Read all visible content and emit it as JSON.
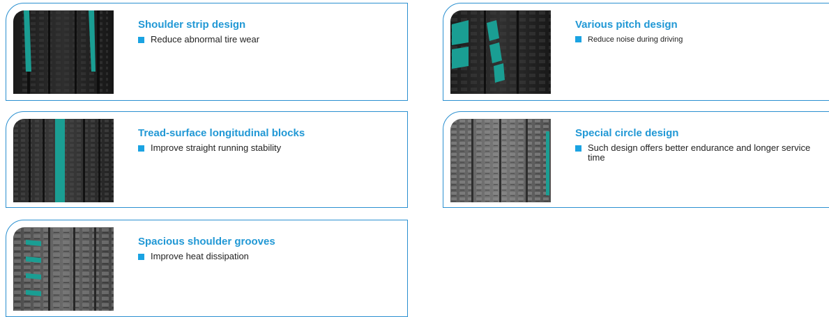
{
  "cards": [
    {
      "title": "Shoulder strip design",
      "description": "Reduce abnormal tire wear"
    },
    {
      "title": "Various pitch design",
      "description": "Reduce noise during driving"
    },
    {
      "title": "Tread-surface longitudinal blocks",
      "description": "Improve straight running stability"
    },
    {
      "title": "Special circle design",
      "description": "Such design offers better endurance and longer service time"
    },
    {
      "title": "Spacious shoulder grooves",
      "description": "Improve heat dissipation"
    }
  ],
  "colors": {
    "title": "#2198d5",
    "bullet": "#1ba3e2",
    "border": "#2a8fd0",
    "highlight": "#1a9e93"
  },
  "icons": [
    "tire-tread-image",
    "bullet-square-icon"
  ]
}
